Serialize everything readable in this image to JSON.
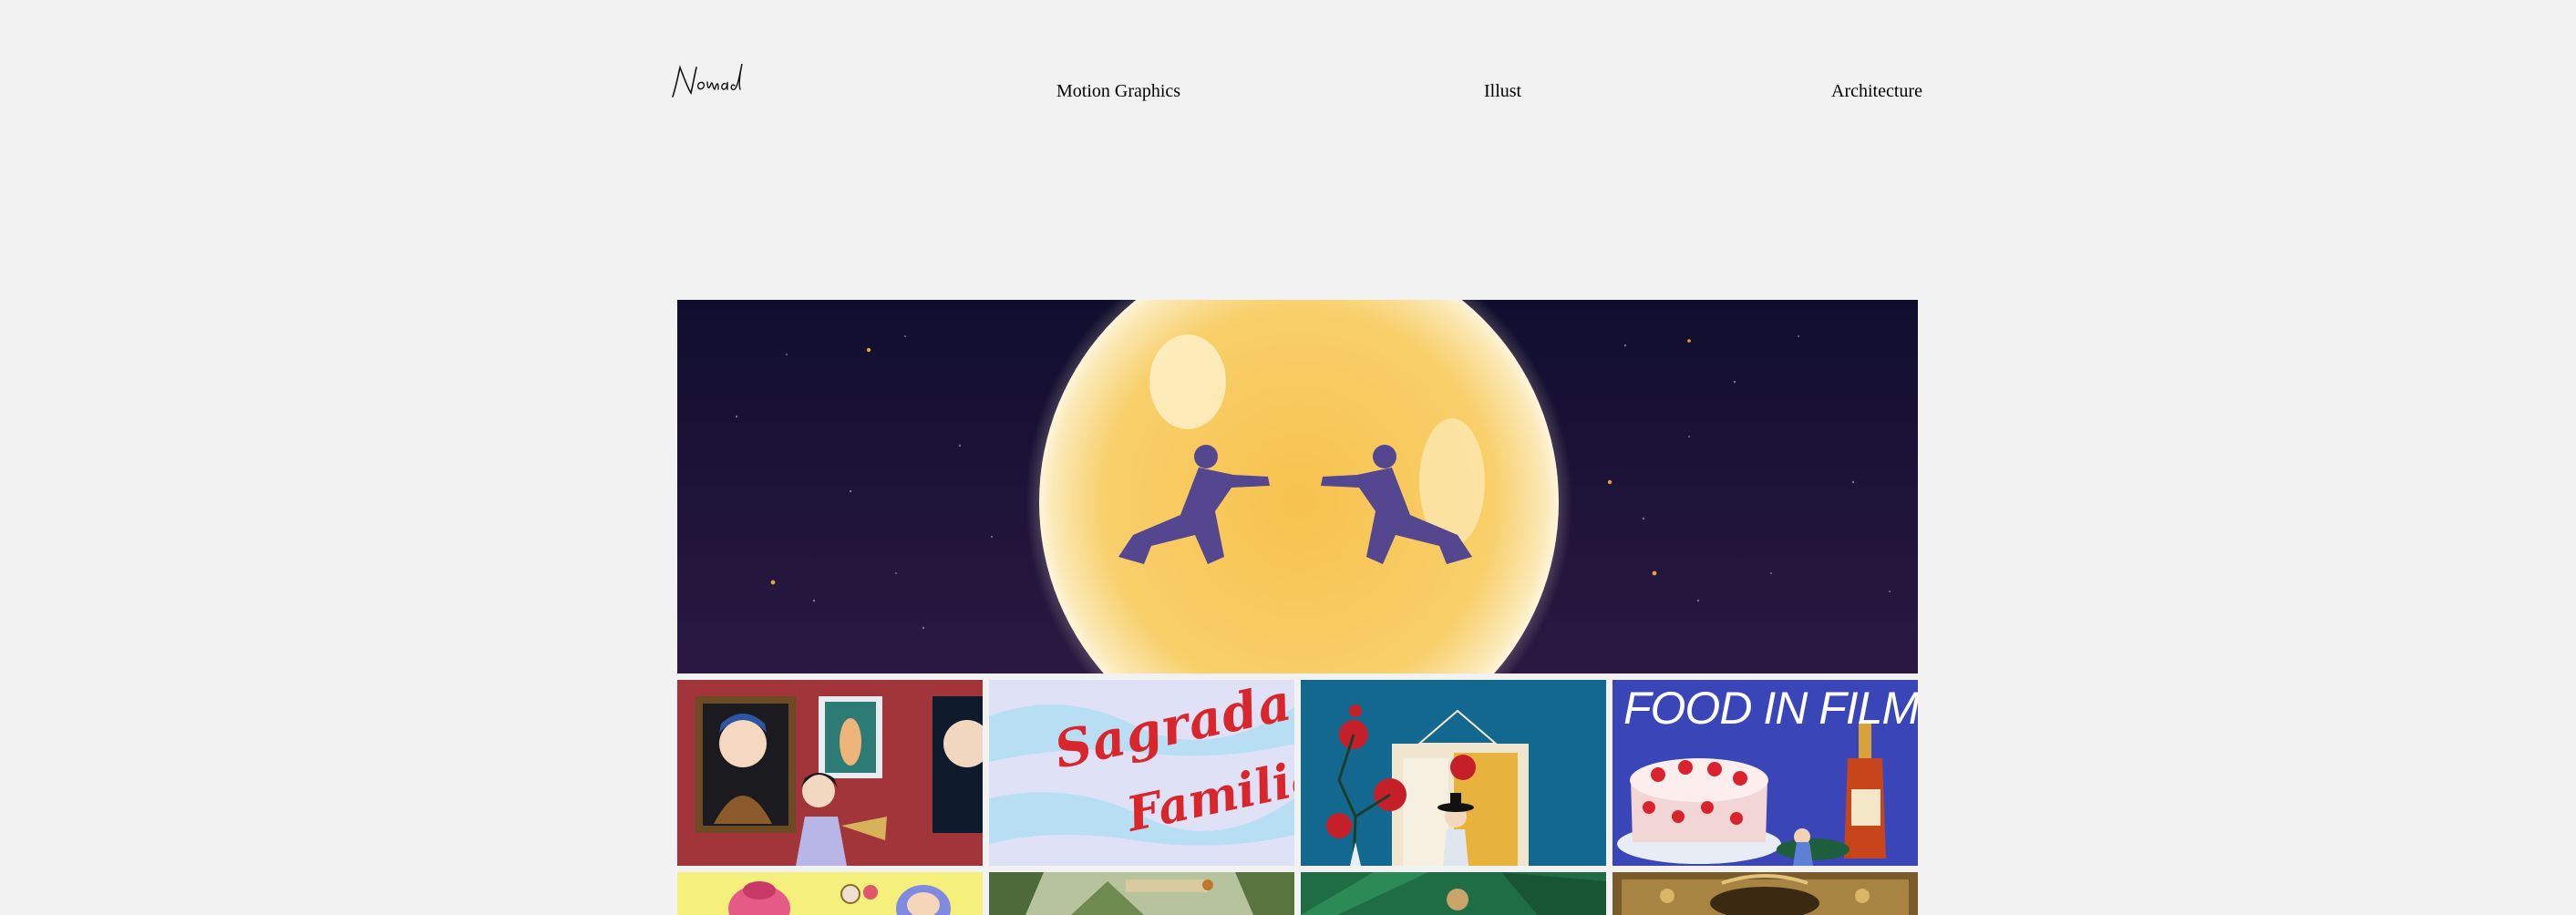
{
  "brand": {
    "logo_text": "Nomad"
  },
  "nav": {
    "items": [
      {
        "label": "Motion Graphics"
      },
      {
        "label": "Illust"
      },
      {
        "label": "Architecture"
      }
    ]
  },
  "gallery": {
    "row1": [
      {
        "name": "museum-paintings"
      },
      {
        "name": "sagrada-familia",
        "caption_line1": "Sagrada",
        "caption_line2": "Familia"
      },
      {
        "name": "korean-window-flowers"
      },
      {
        "name": "food-in-films",
        "title": "FOOD IN FILMS"
      }
    ],
    "row2": [
      {
        "name": "yellow-characters"
      },
      {
        "name": "jungle-scene"
      },
      {
        "name": "green-figure"
      },
      {
        "name": "gold-ornament"
      }
    ]
  },
  "colors": {
    "background": "#f2f2f2",
    "hero_sky": "#1b1538",
    "moon": "#f7c95a",
    "fighters": "#55478f"
  }
}
